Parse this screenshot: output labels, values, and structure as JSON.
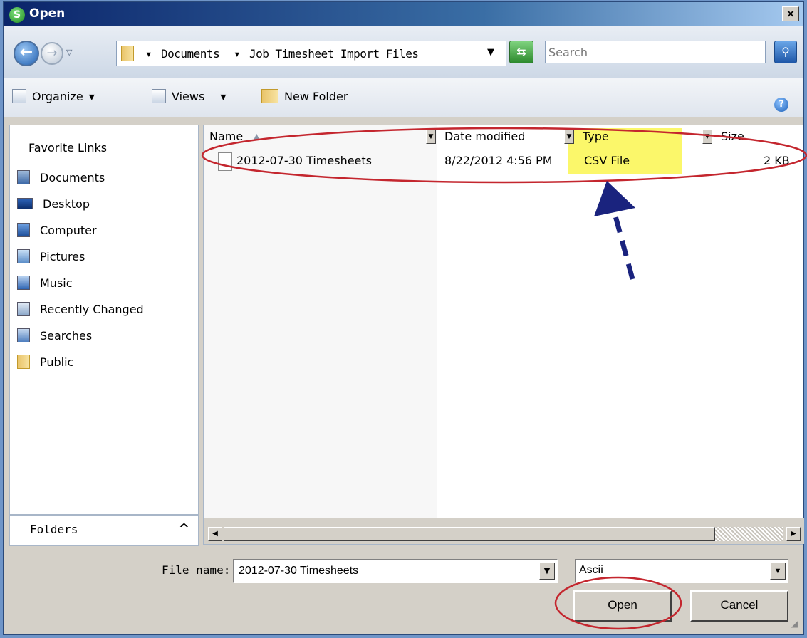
{
  "window": {
    "title": "Open",
    "app_icon_letter": "S",
    "close_glyph": "×"
  },
  "address": {
    "crumbs": [
      "Documents",
      "Job Timesheet Import Files"
    ],
    "crumb_arrow": "▾",
    "search_placeholder": "Search"
  },
  "toolbar": {
    "organize_label": "Organize",
    "views_label": "Views",
    "new_folder_label": "New Folder",
    "dropdown_glyph": "▾"
  },
  "sidebar": {
    "heading": "Favorite Links",
    "items": [
      {
        "label": "Documents",
        "icon": "documents-icon"
      },
      {
        "label": "Desktop",
        "icon": "desktop-icon"
      },
      {
        "label": "Computer",
        "icon": "computer-icon"
      },
      {
        "label": "Pictures",
        "icon": "pictures-icon"
      },
      {
        "label": "Music",
        "icon": "music-icon"
      },
      {
        "label": "Recently Changed",
        "icon": "recently-changed-icon"
      },
      {
        "label": "Searches",
        "icon": "searches-icon"
      },
      {
        "label": "Public",
        "icon": "public-folder-icon"
      }
    ],
    "folders_label": "Folders",
    "folders_chevron": "^"
  },
  "file_list": {
    "columns": [
      "Name",
      "Date modified",
      "Type",
      "Size"
    ],
    "sort_indicator": "▲",
    "rows": [
      {
        "name": "2012-07-30 Timesheets",
        "date_modified": "8/22/2012 4:56 PM",
        "type": "CSV File",
        "size": "2 KB"
      }
    ]
  },
  "footer": {
    "file_name_label": "File name:",
    "file_name_value": "2012-07-30 Timesheets",
    "file_type_value": "Ascii",
    "open_label": "Open",
    "cancel_label": "Cancel"
  },
  "colors": {
    "annotation_red": "#c4262e",
    "annotation_arrow": "#1a237e",
    "highlight_yellow": "#fbf76a",
    "title_bar": "#0a246a"
  }
}
